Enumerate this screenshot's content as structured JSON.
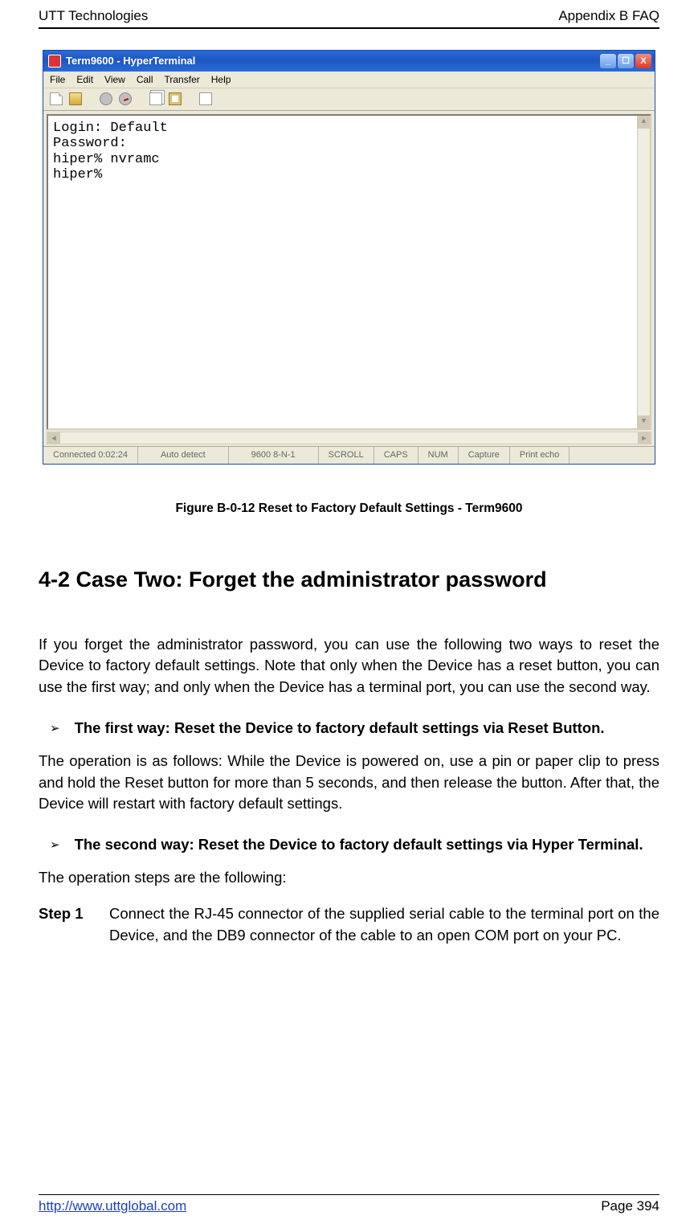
{
  "header": {
    "left": "UTT Technologies",
    "right": "Appendix B FAQ"
  },
  "ht": {
    "title": "Term9600 - HyperTerminal",
    "menus": [
      "File",
      "Edit",
      "View",
      "Call",
      "Transfer",
      "Help"
    ],
    "terminal_lines": "Login: Default\nPassword:\nhiper% nvramc\nhiper%",
    "status": {
      "conn": "Connected 0:02:24",
      "detect": "Auto detect",
      "params": "9600 8-N-1",
      "cells": [
        "SCROLL",
        "CAPS",
        "NUM",
        "Capture",
        "Print echo"
      ]
    },
    "ctrl": {
      "min": "_",
      "max": "☐",
      "close": "X"
    },
    "scroll_arrows": {
      "up": "▲",
      "down": "▼",
      "left": "◄",
      "right": "►"
    }
  },
  "caption": "Figure B-0-12 Reset to Factory Default Settings - Term9600",
  "section_heading": "4-2 Case Two: Forget the administrator password",
  "intro": "If you forget the administrator password, you can use the following two ways to reset the Device to factory default settings. Note that only when the Device has a reset button, you can use the first way; and only when the Device has a terminal port, you can use the second way.",
  "bullet_mark": "➢",
  "way1": {
    "title": "The first way: Reset the Device to factory default settings via Reset Button.",
    "body": "The operation is as follows: While the Device is powered on, use a pin or paper clip to press and hold the Reset button for more than 5 seconds, and then release the button. After that, the Device will restart with factory default settings."
  },
  "way2": {
    "title": "The second way: Reset the Device to factory default settings via Hyper Terminal.",
    "lead": "The operation steps are the following:",
    "step1_label": "Step 1",
    "step1_body": "Connect the RJ-45 connector of the supplied serial cable to the terminal port on the Device, and the DB9 connector of the cable to an open COM port on your PC."
  },
  "footer": {
    "url": "http://www.uttglobal.com",
    "page": "Page 394"
  }
}
